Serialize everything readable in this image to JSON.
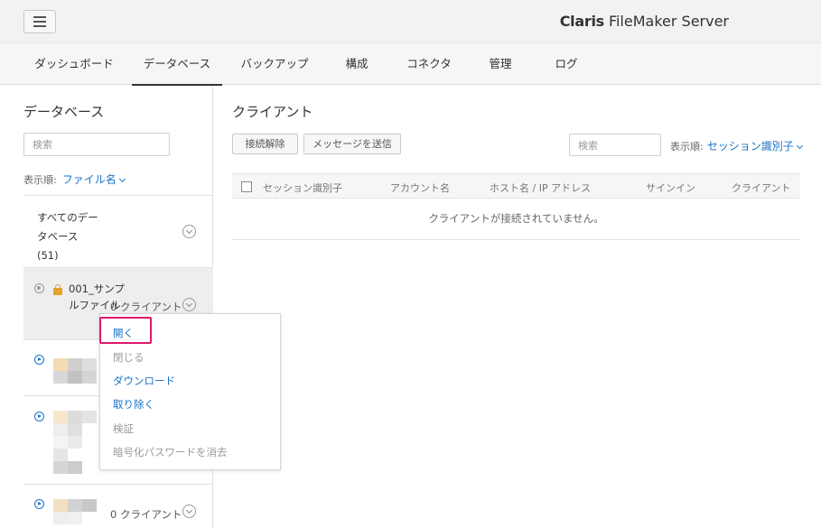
{
  "header": {
    "menu_icon": "hamburger-icon",
    "brand_bold": "Claris",
    "brand_rest": " FileMaker Server"
  },
  "nav": {
    "tabs": [
      {
        "label": "ダッシュボード"
      },
      {
        "label": "データベース",
        "active": true
      },
      {
        "label": "バックアップ"
      },
      {
        "label": "構成"
      },
      {
        "label": "コネクタ"
      },
      {
        "label": "管理"
      },
      {
        "label": "ログ"
      }
    ]
  },
  "left": {
    "title": "データベース",
    "search_placeholder": "検索",
    "sort_label": "表示順:",
    "sort_value": "ファイル名",
    "all_databases": "すべてのデータベース (51)",
    "items": [
      {
        "name": "001_サンプルファイル",
        "clients": "0 クライアント",
        "status_icon": "stopped-circle-icon",
        "lock_icon": "lock-icon"
      },
      {
        "status_icon": "play-circle-icon"
      },
      {
        "status_icon": "play-circle-icon"
      },
      {
        "clients": "0 クライアント",
        "status_icon": "play-circle-icon"
      }
    ]
  },
  "context_menu": {
    "items": [
      {
        "label": "開く",
        "enabled": true
      },
      {
        "label": "閉じる",
        "enabled": false
      },
      {
        "label": "ダウンロード",
        "enabled": true
      },
      {
        "label": "取り除く",
        "enabled": true
      },
      {
        "label": "検証",
        "enabled": false
      },
      {
        "label": "暗号化パスワードを消去",
        "enabled": false
      }
    ],
    "highlight_color": "#e0176b"
  },
  "right": {
    "title": "クライアント",
    "disconnect_button": "接続解除",
    "send_message_button": "メッセージを送信",
    "search_placeholder": "検索",
    "sort_label": "表示順:",
    "sort_value": "セッション識別子",
    "columns": [
      "セッション識別子",
      "アカウント名",
      "ホスト名 / IP アドレス",
      "サインイン",
      "クライアント"
    ],
    "empty_message": "クライアントが接続されていません。"
  },
  "colors": {
    "accent": "#1a73c8",
    "disabled": "#9b9b9b"
  }
}
